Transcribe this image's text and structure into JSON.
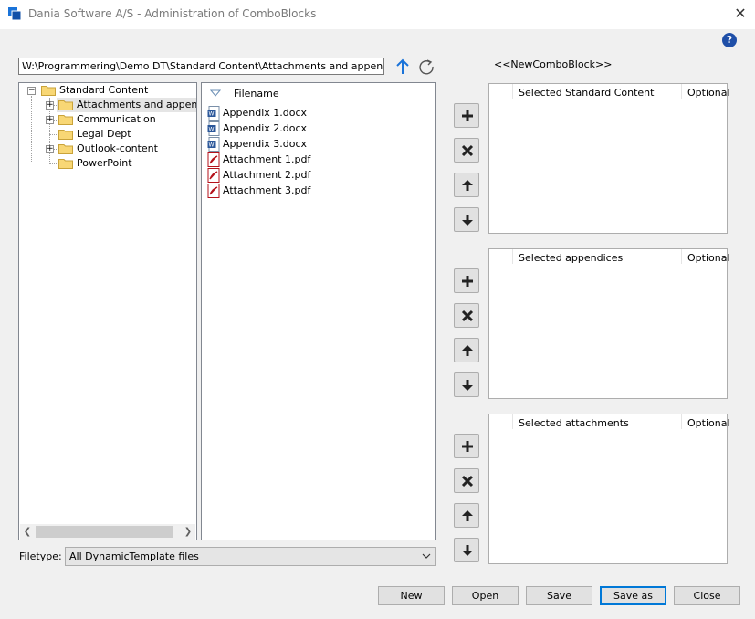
{
  "window": {
    "title": "Dania Software A/S - Administration of ComboBlocks"
  },
  "path": {
    "value": "W:\\Programmering\\Demo DT\\Standard Content\\Attachments and appendices\\"
  },
  "comboblock_name": "<<NewComboBlock>>",
  "tree": {
    "root": "Standard Content",
    "items": [
      {
        "label": "Attachments and appendices",
        "expandable": true,
        "selected": true
      },
      {
        "label": "Communication",
        "expandable": true
      },
      {
        "label": "Legal Dept",
        "expandable": false
      },
      {
        "label": "Outlook-content",
        "expandable": true
      },
      {
        "label": "PowerPoint",
        "expandable": false
      }
    ]
  },
  "files": {
    "header": "Filename",
    "items": [
      {
        "name": "Appendix 1.docx",
        "icon": "word-doc-icon"
      },
      {
        "name": "Appendix 2.docx",
        "icon": "word-doc-icon"
      },
      {
        "name": "Appendix 3.docx",
        "icon": "word-doc-icon"
      },
      {
        "name": "Attachment 1.pdf",
        "icon": "pdf-icon"
      },
      {
        "name": "Attachment 2.pdf",
        "icon": "pdf-icon"
      },
      {
        "name": "Attachment 3.pdf",
        "icon": "pdf-icon"
      }
    ]
  },
  "filetype": {
    "label": "Filetype:",
    "value": "All DynamicTemplate files"
  },
  "lists": [
    {
      "title": "Selected Standard Content",
      "optional_label": "Optional"
    },
    {
      "title": "Selected appendices",
      "optional_label": "Optional"
    },
    {
      "title": "Selected attachments",
      "optional_label": "Optional"
    }
  ],
  "buttons": {
    "new": "New",
    "open": "Open",
    "save": "Save",
    "save_as": "Save as",
    "close": "Close"
  },
  "colors": {
    "accent": "#0078d7",
    "help": "#1f4fa8"
  }
}
